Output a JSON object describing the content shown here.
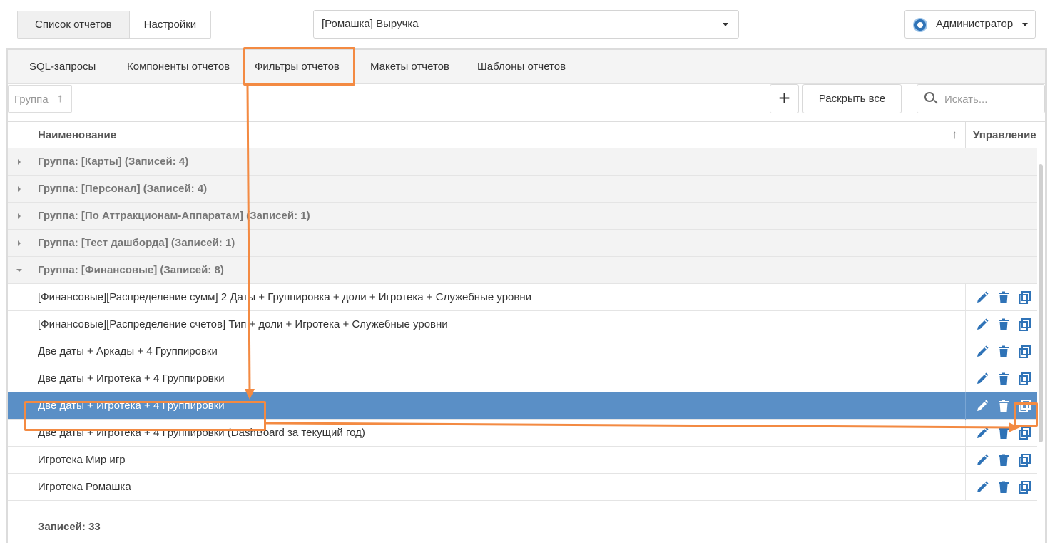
{
  "top_tabs": [
    "Список отчетов",
    "Настройки"
  ],
  "report_select": {
    "value": "[Ромашка] Выручка"
  },
  "user": {
    "label": "Администратор"
  },
  "sub_tabs": [
    "SQL-запросы",
    "Компоненты отчетов",
    "Фильтры отчетов",
    "Макеты отчетов",
    "Шаблоны отчетов"
  ],
  "toolbar": {
    "group_chip": "Группа",
    "group_sort_glyph": "↑",
    "add_glyph": "+",
    "expand_all": "Раскрыть все",
    "search_placeholder": "Искать..."
  },
  "grid": {
    "col_name": "Наименование",
    "col_sort_glyph": "↑",
    "col_controls": "Управление",
    "groups": [
      "Группа: [Карты] (Записей: 4)",
      "Группа: [Персонал] (Записей: 4)",
      "Группа: [По Аттракционам-Аппаратам] (Записей: 1)",
      "Группа: [Тест дашборда] (Записей: 1)",
      "Группа: [Финансовые] (Записей: 8)"
    ],
    "items": [
      "[Финансовые][Распределение сумм] 2 Даты + Группировка + доли + Игротека + Служебные уровни",
      "[Финансовые][Распределение счетов] Тип + доли + Игротека + Служебные уровни",
      "Две даты + Аркады + 4 Группировки",
      "Две даты + Игротека + 4 Группировки",
      "Две даты + Игротека + 4 Группировки",
      "Две даты + Игротека + 4 Группировки (DashBoard за текущий год)",
      "Игротека Мир игр",
      "Игротека Ромашка"
    ],
    "footer": "Записей: 33"
  },
  "colors": {
    "accent": "#f38a42",
    "selected_row": "#5a8fc6",
    "icon": "#2f73b7"
  },
  "icons": [
    "pencil-icon",
    "trash-icon",
    "copy-icon",
    "globe-icon",
    "search-icon",
    "chevron-down-icon"
  ]
}
